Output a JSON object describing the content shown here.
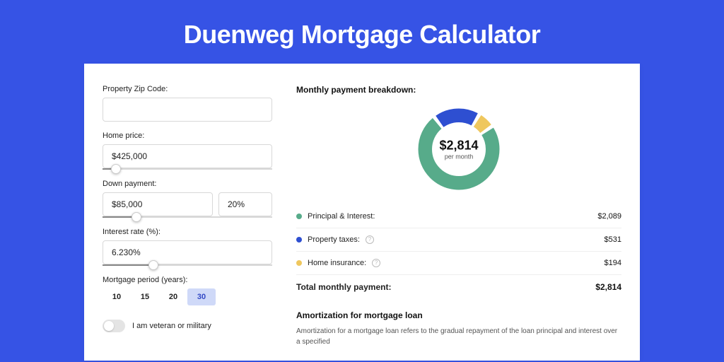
{
  "title": "Duenweg Mortgage Calculator",
  "form": {
    "zip": {
      "label": "Property Zip Code:",
      "value": ""
    },
    "home_price": {
      "label": "Home price:",
      "value": "$425,000",
      "slider_pct": 8
    },
    "down_payment": {
      "label": "Down payment:",
      "value": "$85,000",
      "pct": "20%",
      "slider_pct": 20
    },
    "interest_rate": {
      "label": "Interest rate (%):",
      "value": "6.230%",
      "slider_pct": 30
    },
    "period": {
      "label": "Mortgage period (years):",
      "options": [
        "10",
        "15",
        "20",
        "30"
      ],
      "active": "30"
    },
    "veteran": {
      "label": "I am veteran or military"
    }
  },
  "breakdown": {
    "title": "Monthly payment breakdown:",
    "center_amount": "$2,814",
    "center_sub": "per month",
    "items": [
      {
        "label": "Principal & Interest:",
        "value": "$2,089",
        "color": "#57ab8a",
        "help": false
      },
      {
        "label": "Property taxes:",
        "value": "$531",
        "color": "#2e4fd1",
        "help": true
      },
      {
        "label": "Home insurance:",
        "value": "$194",
        "color": "#efc75e",
        "help": true
      }
    ],
    "total_label": "Total monthly payment:",
    "total_value": "$2,814"
  },
  "amort": {
    "title": "Amortization for mortgage loan",
    "text": "Amortization for a mortgage loan refers to the gradual repayment of the loan principal and interest over a specified"
  },
  "chart_data": {
    "type": "pie",
    "title": "Monthly payment breakdown",
    "series": [
      {
        "name": "Principal & Interest",
        "value": 2089,
        "color": "#57ab8a"
      },
      {
        "name": "Property taxes",
        "value": 531,
        "color": "#2e4fd1"
      },
      {
        "name": "Home insurance",
        "value": 194,
        "color": "#efc75e"
      }
    ],
    "total": 2814,
    "center_label": "$2,814 per month"
  }
}
